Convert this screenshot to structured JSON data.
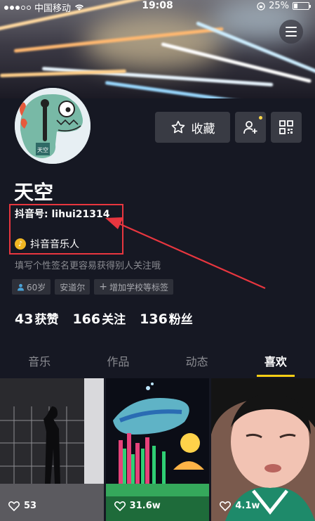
{
  "status_bar": {
    "carrier": "中国移动",
    "time": "19:08",
    "battery": "25%"
  },
  "profile": {
    "nickname": "天空",
    "douyin_id": "抖音号: lihui21314",
    "music_badge": "抖音音乐人",
    "signature": "填写个性签名更容易获得别人关注哦",
    "avatar_caption": "天空"
  },
  "actions": {
    "favorite_label": "收藏"
  },
  "tags": [
    {
      "label": "60岁",
      "icon": "person-icon"
    },
    {
      "label": "安道尔"
    },
    {
      "label": "增加学校等标签",
      "icon": "plus-icon"
    }
  ],
  "stats": [
    {
      "value": "43",
      "label": "获赞"
    },
    {
      "value": "166",
      "label": "关注"
    },
    {
      "value": "136",
      "label": "粉丝"
    }
  ],
  "tabs": [
    {
      "label": "音乐",
      "active": false
    },
    {
      "label": "作品",
      "active": false
    },
    {
      "label": "动态",
      "active": false
    },
    {
      "label": "喜欢",
      "active": true
    }
  ],
  "videos": [
    {
      "likes": "53"
    },
    {
      "likes": "31.6w"
    },
    {
      "likes": "4.1w"
    }
  ],
  "colors": {
    "background": "#161823",
    "accent_tab": "#face15",
    "annotation_red": "#e8363f",
    "button_bg": "#393b44"
  }
}
